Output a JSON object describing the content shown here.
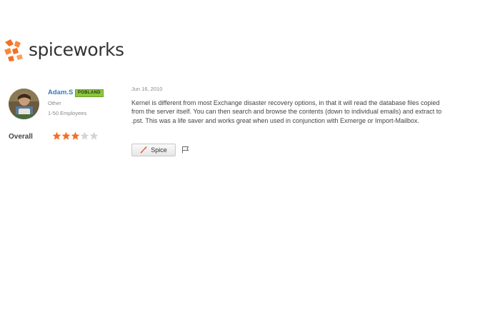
{
  "brand": {
    "logo_text": "spiceworks",
    "accent_color": "#f37021"
  },
  "reviewer": {
    "name": "Adam.S",
    "country": "POBLAND",
    "industry": "Other",
    "company_size": "1-50 Employees",
    "avatar_icon": "user-photo"
  },
  "rating": {
    "label": "Overall",
    "value": 3,
    "max": 5
  },
  "review": {
    "date": "Jun 16, 2010",
    "body": "Kernel is different from most Exchange disaster recovery options, in that it will read the database files copied from the server itself. You can then search and browse the contents (down to individual emails) and extract to .pst. This was a life saver and works great when used in conjunction with Exmerge or Import-Mailbox."
  },
  "actions": {
    "spice_label": "Spice",
    "flag_icon": "flag-icon"
  }
}
